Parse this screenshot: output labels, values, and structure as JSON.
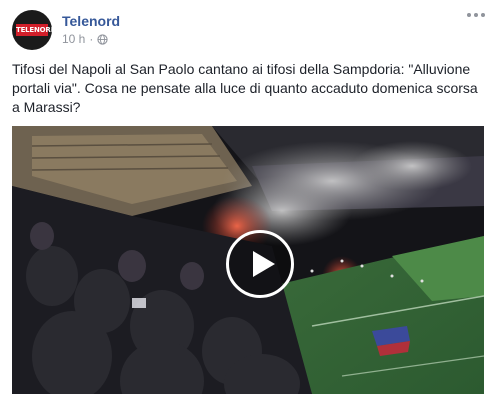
{
  "post": {
    "page_name": "Telenord",
    "avatar_text": "TELENORD",
    "timestamp": "10 h",
    "separator": "·",
    "privacy_icon": "globe-icon",
    "more_icon": "more-horizontal-icon",
    "text": "Tifosi del Napoli al San Paolo cantano ai tifosi della Sampdoria: \"Alluvione portali via\". Cosa ne pensate alla luce di quanto accaduto domenica scorsa a Marassi?"
  },
  "video": {
    "play_icon": "play-icon",
    "state": "paused"
  },
  "colors": {
    "link": "#365899",
    "meta": "#90949c",
    "text": "#1d2129",
    "badge": "#d21f2a"
  }
}
